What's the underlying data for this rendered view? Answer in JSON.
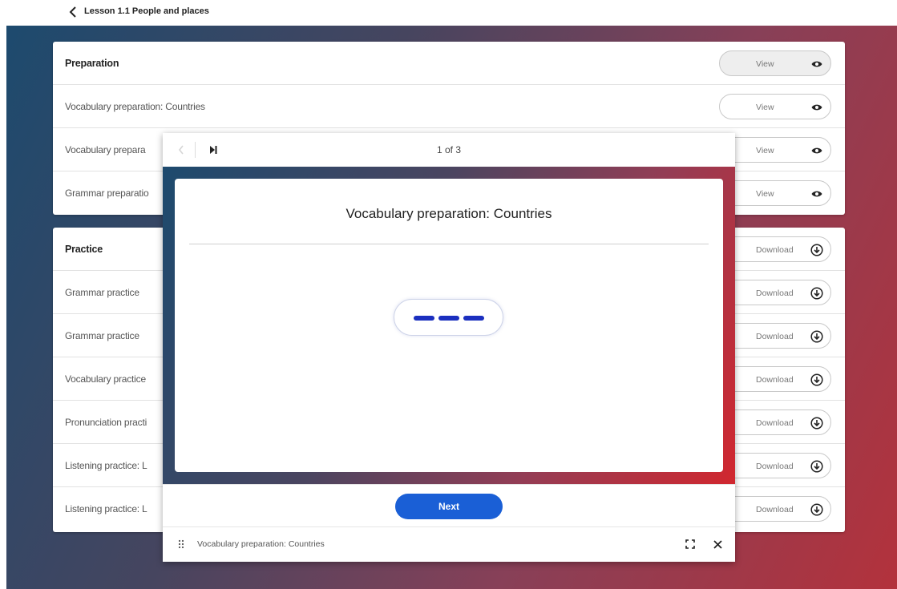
{
  "header": {
    "back_icon": "chevron-left-icon",
    "lesson_title": "Lesson 1.1 People and places"
  },
  "sections": [
    {
      "title": "Preparation",
      "header_action": "View",
      "action_icon": "eye-icon",
      "items": [
        {
          "label": "Vocabulary preparation: Countries",
          "action": "View"
        },
        {
          "label": "Vocabulary prepara",
          "action": "View"
        },
        {
          "label": "Grammar preparatio",
          "action": "View"
        }
      ]
    },
    {
      "title": "Practice",
      "header_action": "Download",
      "action_icon": "download-icon",
      "items": [
        {
          "label": "Grammar practice",
          "action": "Download"
        },
        {
          "label": "Grammar practice",
          "action": "Download"
        },
        {
          "label": "Vocabulary practice",
          "action": "Download"
        },
        {
          "label": "Pronunciation practi",
          "action": "Download"
        },
        {
          "label": "Listening practice: L",
          "action": "Download"
        },
        {
          "label": "Listening practice: L",
          "action": "Download"
        }
      ]
    }
  ],
  "viewer": {
    "page_counter": "1 of 3",
    "activity_title": "Vocabulary preparation: Countries",
    "next_label": "Next",
    "status_title": "Vocabulary preparation: Countries",
    "accent_color": "#1a5fd6",
    "loader_color": "#1b2fbf"
  }
}
